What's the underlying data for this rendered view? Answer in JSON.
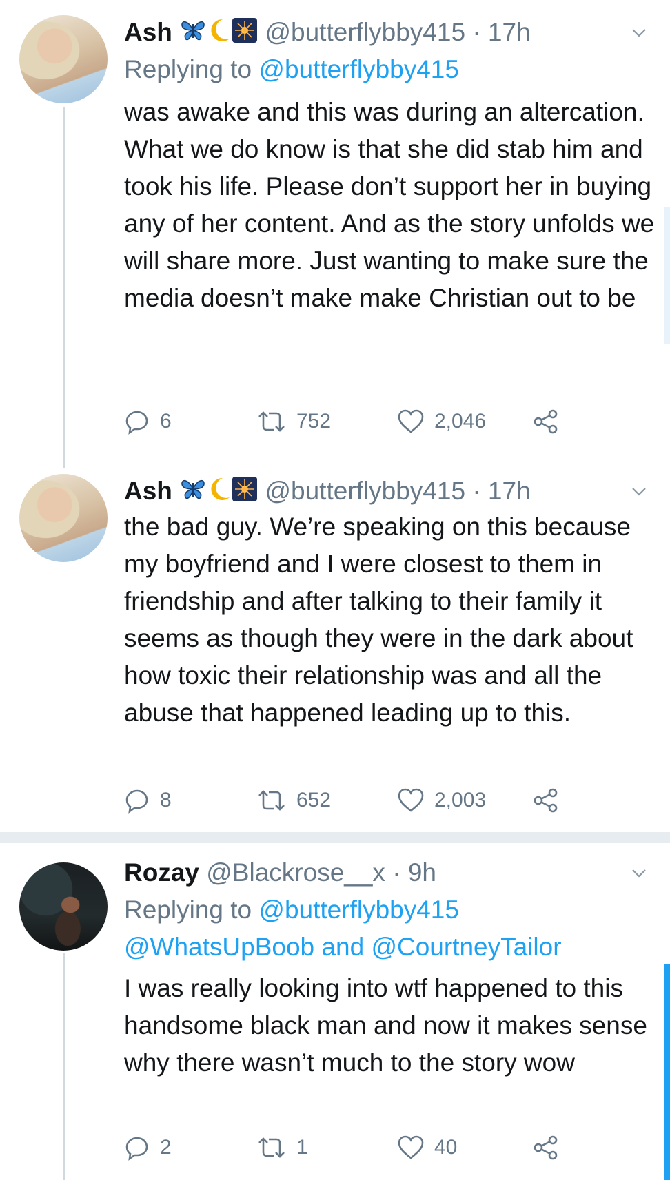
{
  "tweets": [
    {
      "name": "Ash",
      "handle": "@butterflybby415",
      "sep": "·",
      "time": "17h",
      "reply_prefix": "Replying to",
      "reply_to": "@butterflybby415",
      "text": "was awake and this was during an altercation. What we do know is that she did stab him and took his life. Please don’t support her in buying any of her content. And as the story unfolds we will share more. Just wanting to make sure the media doesn’t make make Christian out to be",
      "replies": "6",
      "retweets": "752",
      "likes": "2,046"
    },
    {
      "name": "Ash",
      "handle": "@butterflybby415",
      "sep": "·",
      "time": "17h",
      "text": "the bad guy. We’re speaking on this because my boyfriend and I were closest to them in friendship and after talking to their family it seems as though they were in the dark about how toxic their relationship was and all the abuse that happened leading up to this.",
      "replies": "8",
      "retweets": "652",
      "likes": "2,003"
    },
    {
      "name": "Rozay",
      "handle": "@Blackrose__x",
      "sep": "·",
      "time": "9h",
      "reply_prefix": "Replying to",
      "reply_to": "@butterflybby415",
      "reply_line2_a": "@WhatsUpBoob",
      "reply_line2_and": "and",
      "reply_line2_b": "@CourtneyTailor",
      "text": "I was really looking into wtf happened to this handsome black man and now it makes sense why there wasn’t much to the story wow",
      "replies": "2",
      "retweets": "1",
      "likes": "40"
    }
  ],
  "icons": {
    "name_emojis": [
      "butterfly-emoji",
      "crescent-moon-emoji",
      "sparkler-night-emoji"
    ],
    "actions": [
      "reply-icon",
      "retweet-icon",
      "like-icon",
      "share-icon"
    ],
    "menu": "chevron-down-icon"
  },
  "colors": {
    "link": "#1da1f2",
    "muted": "#657786",
    "text": "#14171a",
    "thread_line": "#cfd9de",
    "separator": "#e6ecf0"
  }
}
